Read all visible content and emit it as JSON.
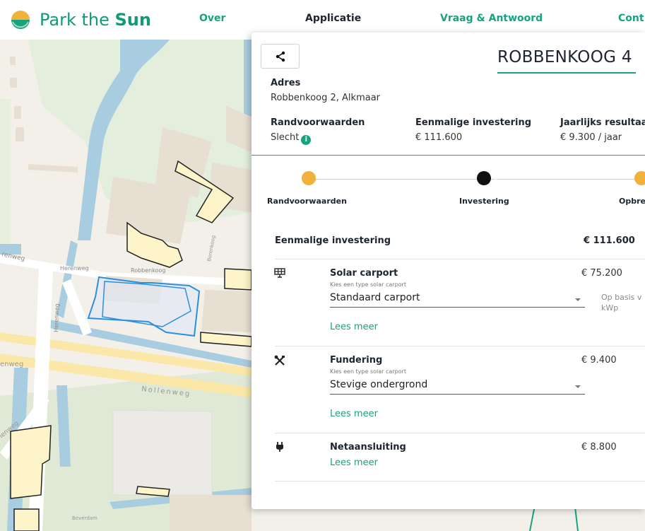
{
  "header": {
    "logo_text_light": "Park the ",
    "logo_text_bold": "Sun",
    "nav": [
      {
        "label": "Over",
        "active": false
      },
      {
        "label": "Applicatie",
        "active": true
      },
      {
        "label": "Vraag & Antwoord",
        "active": false
      },
      {
        "label": "Cont",
        "active": false
      }
    ]
  },
  "map": {
    "street_labels": [
      "Herenweg",
      "Herenweg",
      "Robbenkoog",
      "Berenkoog",
      "Herenweg",
      "renweg",
      "enweg",
      "Nollenweg",
      "Beverdam",
      "lenweg"
    ]
  },
  "panel": {
    "share_icon": "share-icon",
    "title": "ROBBENKOOG 4",
    "address_label": "Adres",
    "address_value": "Robbenkoog 2, Alkmaar",
    "summary": [
      {
        "label": "Randvoorwaarden",
        "value": "Slecht"
      },
      {
        "label": "Eenmalige investering",
        "value": "€ 111.600"
      },
      {
        "label": "Jaarlijks resultaa",
        "value": "€ 9.300 / jaar"
      }
    ],
    "steps": [
      {
        "label": "Randvoorwaarden",
        "color": "#f0b23a"
      },
      {
        "label": "Investering",
        "color": "#111111"
      },
      {
        "label": "Opbre",
        "color": "#f0b23a"
      }
    ],
    "investment": {
      "title": "Eenmalige investering",
      "amount": "€ 111.600",
      "items": [
        {
          "icon": "solar-panel-icon",
          "title": "Solar carport",
          "hint": "Kies een type solar carport",
          "selected": "Standaard carport",
          "link": "Lees meer",
          "price": "€ 75.200",
          "note": "Op basis v kWp"
        },
        {
          "icon": "tools-icon",
          "title": "Fundering",
          "hint": "Kies een type solar carport",
          "selected": "Stevige ondergrond",
          "link": "Lees meer",
          "price": "€ 9.400"
        },
        {
          "icon": "plug-icon",
          "title": "Netaansluiting",
          "link": "Lees meer",
          "price": "€ 8.800"
        }
      ]
    }
  },
  "colors": {
    "brand_green": "#17a37f",
    "orange": "#f0b23a",
    "building_fill": "#fdf5c9"
  }
}
